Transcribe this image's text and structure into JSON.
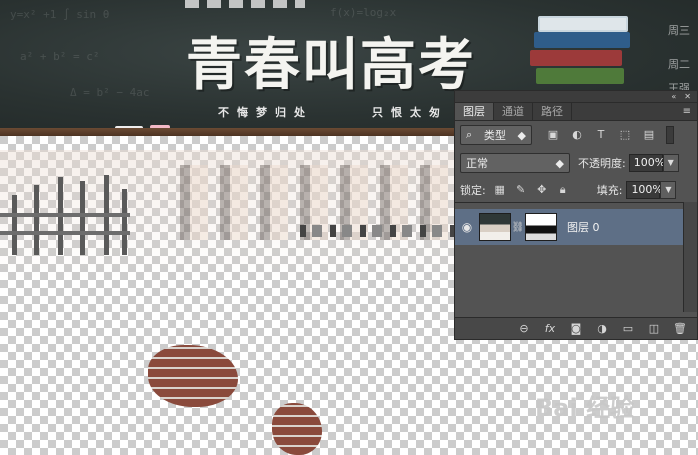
{
  "canvas": {
    "headline": "青春叫高考",
    "subline_left": "不悔梦归处",
    "subline_right": "只恨太匆",
    "side_labels": [
      "周三",
      "周二",
      "王强"
    ]
  },
  "watermark": {
    "text": "Bai 经验"
  },
  "layers_panel": {
    "tabs": [
      {
        "label": "图层",
        "active": true
      },
      {
        "label": "通道",
        "active": false
      },
      {
        "label": "路径",
        "active": false
      }
    ],
    "top_controls": {
      "collapse": "«",
      "close": "✕"
    },
    "filter": {
      "kind_label": "类型",
      "icons": [
        "image-filter-icon",
        "adjustment-filter-icon",
        "type-filter-icon",
        "shape-filter-icon",
        "smart-object-filter-icon"
      ]
    },
    "blend_mode": "正常",
    "opacity_label": "不透明度:",
    "opacity_value": "100%",
    "lock_label": "锁定:",
    "fill_label": "填充:",
    "fill_value": "100%",
    "layers": [
      {
        "name": "图层 0",
        "visible": true,
        "selected": true
      }
    ],
    "footer_icons": [
      "link-layers-icon",
      "fx-icon",
      "add-mask-icon",
      "adjustment-layer-icon",
      "new-group-icon",
      "new-layer-icon",
      "delete-layer-icon"
    ],
    "accent_color": "#5e6f86"
  }
}
